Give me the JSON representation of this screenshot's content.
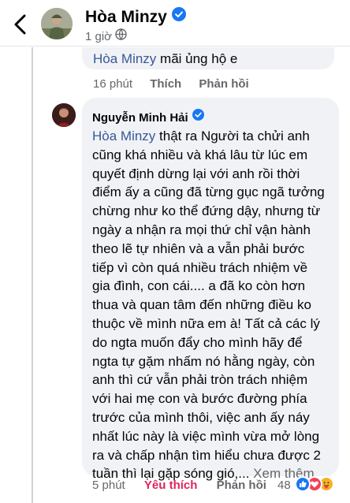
{
  "header": {
    "name": "Hòa Minzy",
    "time": "1 giờ"
  },
  "previous_reply": {
    "mention": "Hòa Minzy",
    "text": " mãi ủng hộ e",
    "time": "16 phút",
    "like_label": "Thích",
    "reply_label": "Phản hồi"
  },
  "comment": {
    "author": "Nguyễn Minh Hải",
    "mention": "Hòa Minzy",
    "lines": [
      " thật ra Người ta chửi anh",
      "cũng khá nhiều và khá lâu từ lúc em",
      "quyết định dừng lại với anh rồi thời",
      "điểm ấy a cũng đã từng gục ngã tưởng",
      "chừng như ko thể đứng dậy, nhưng từ",
      "ngày a nhận ra mọi thứ chỉ vận hành",
      "theo lẽ tự nhiên và a vẫn phải bước",
      "tiếp vì còn quá nhiều trách nhiệm về",
      "gia đình, con cái.... a đã ko còn hơn",
      "thua và quan tâm đến những điều ko",
      "thuộc về mình nữa em à! Tất cả các lý",
      "do ngta muốn đẩy cho mình hãy để",
      "ngta tự gặm nhấm nó hằng ngày, còn",
      "anh thì cứ vẫn phải tròn trách nhiệm",
      "với hai mẹ con và bước đường phía",
      "trước của mình thôi, việc anh ấy náy",
      "nhất lúc này là việc mình vừa mở lòng",
      "ra và chấp nhận tìm hiểu chưa được 2",
      "tuần thì lại gặp sóng gió,... "
    ],
    "see_more": "Xem thêm",
    "time": "5 phút",
    "like_label": "Yêu thích",
    "reply_label": "Phản hồi",
    "reaction_count": "48",
    "reactions": [
      "like-reaction",
      "love-reaction",
      "care-reaction"
    ]
  },
  "colors": {
    "mention": "#385898",
    "bubble": "#f0f2f5",
    "secondary_text": "#65676b",
    "love": "#e0245e",
    "verified": "#1877f2"
  }
}
